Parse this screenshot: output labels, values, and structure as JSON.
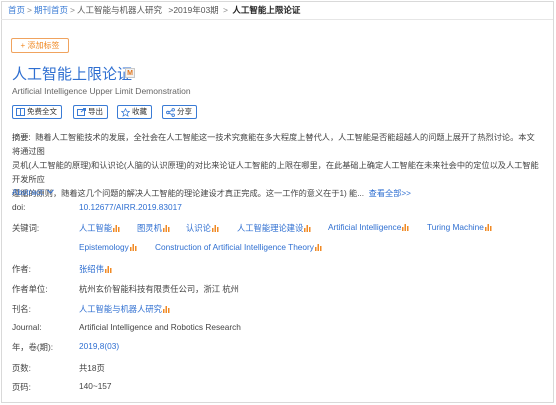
{
  "breadcrumb": {
    "home": "首页",
    "journal_home": "期刊首页",
    "journal": "人工智能与机器人研究",
    "issue": ">2019年03期",
    "current": "人工智能上限论证"
  },
  "actions": {
    "add_tag": "+ 添加标签",
    "free_fulltext": "免费全文",
    "export": "导出",
    "favorite": "收藏",
    "share": "分享"
  },
  "article": {
    "title": "人工智能上限论证",
    "badge": "M",
    "subtitle": "Artificial Intelligence Upper Limit Demonstration"
  },
  "abstract": {
    "label": "摘要:",
    "line1": "随着人工智能技术的发展，全社会在人工智能这一技术究竟能在多大程度上替代人，人工智能是否能超越人的问题上展开了热烈讨论。本文将通过图",
    "line2": "灵机(人工智能的原理)和认识论(人脑的认识原理)的对比来论证人工智能的上限在哪里，在此基础上确定人工智能在未来社会中的定位以及人工智能开发所应",
    "line3": "遵循的原则，随着这几个问题的解决人工智能的理论建设才真正完成。这一工作的意义在于1) 能...",
    "more": "查看全部>>",
    "en_label": "Abstract:"
  },
  "fields": {
    "doi_label": "doi:",
    "doi_value": "10.12677/AIRR.2019.83017",
    "keywords_label": "关键词:",
    "author_label": "作者:",
    "author_value": "张绍伟",
    "affiliation_label": "作者单位:",
    "affiliation_value": "杭州玄价智能科技有限责任公司，浙江 杭州",
    "journal_cn_label": "刊名:",
    "journal_cn_value": "人工智能与机器人研究",
    "journal_label": "Journal:",
    "journal_value": "Artificial Intelligence and Robotics Research",
    "year_label": "年，卷(期):",
    "year_value": "2019,8(03)",
    "pages_label": "页数:",
    "pages_value": "共18页",
    "pagenum_label": "页码:",
    "pagenum_value": "140~157"
  },
  "keywords": [
    "人工智能",
    "图灵机",
    "认识论",
    "人工智能理论建设",
    "Artificial Intelligence",
    "Turing Machine",
    "Epistemology",
    "Construction of Artificial Intelligence Theory"
  ],
  "colors": {
    "link": "#2f6fd1",
    "accent": "#f08a24",
    "button_border": "#3a7bd5"
  }
}
